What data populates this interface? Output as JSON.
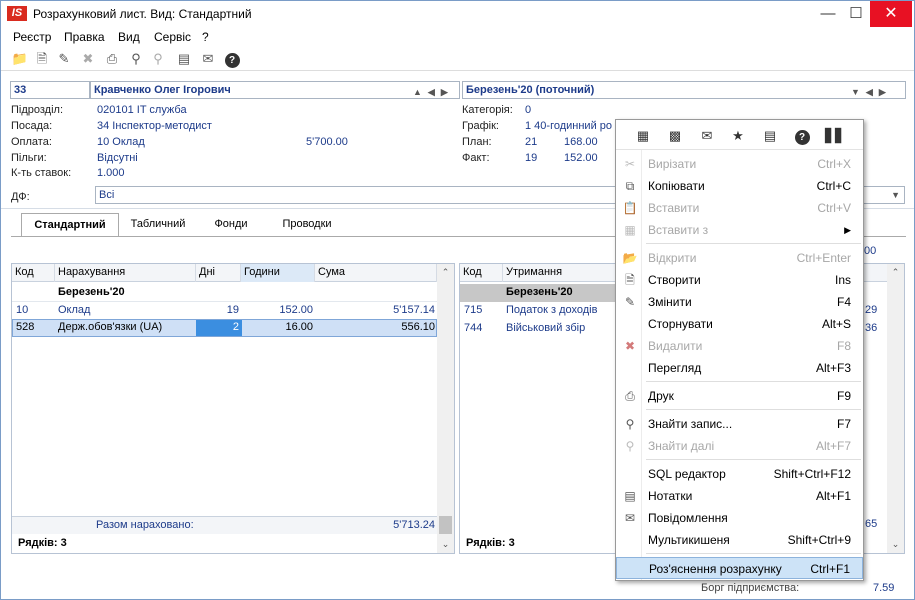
{
  "window": {
    "app_icon": "IS",
    "title": "Розрахунковий лист. Вид: Стандартний",
    "min_icon": "minimize-icon",
    "max_icon": "maximize-icon",
    "close_icon": "close-icon"
  },
  "menu": [
    "Реєстр",
    "Правка",
    "Вид",
    "Сервіс",
    "?"
  ],
  "toolbar_icons": [
    "folder-icon",
    "new-doc-icon",
    "edit-doc-icon",
    "delete-icon",
    "print-icon",
    "find-icon",
    "find-next-icon",
    "notes-icon",
    "mail-icon",
    "help-icon"
  ],
  "header": {
    "employee_id": "33",
    "employee_name": "Кравченко Олег Ігорович",
    "period": "Березень'20 (поточний)"
  },
  "info_left": {
    "department_label": "Підрозділ:",
    "department_value": "020101  IT служба",
    "position_label": "Посада:",
    "position_value": "34  Інспектор-методист",
    "pay_label": "Оплата:",
    "pay_value": "10  Оклад",
    "pay_amount": "5'700.00",
    "benefits_label": "Пільги:",
    "benefits_value": "Відсутні",
    "rate_label": "К-ть ставок:",
    "rate_value": "1.000",
    "df_label": "ДФ:",
    "df_value": "Всі"
  },
  "info_right": {
    "category_label": "Категорія:",
    "category_value": "0",
    "schedule_label": "Графік:",
    "schedule_value": "1  40-годинний ро",
    "plan_label": "План:",
    "plan_days": "21",
    "plan_hours": "168.00",
    "fact_label": "Факт:",
    "fact_days": "19",
    "fact_hours": "152.00"
  },
  "tabs": [
    "Стандартний",
    "Табличний",
    "Фонди",
    "Проводки"
  ],
  "accruals": {
    "columns": [
      "Код",
      "Нарахування",
      "Дні",
      "Години",
      "Сума"
    ],
    "group_title": "Березень'20",
    "rows": [
      {
        "code": "10",
        "name": "Оклад",
        "days": "19",
        "hours": "152.00",
        "sum": "5'157.14"
      },
      {
        "code": "528",
        "name": "Держ.обов'язки (UA)",
        "days": "2",
        "hours": "16.00",
        "sum": "556.10"
      }
    ],
    "total_label": "Разом нараховано:",
    "total_value": "5'713.24",
    "rows_count": "Рядків: 3"
  },
  "deductions": {
    "columns": [
      "Код",
      "Утримання"
    ],
    "group_title": "Березень'20",
    "rows": [
      {
        "code": "715",
        "name": "Податок з доходів",
        "tail": "29"
      },
      {
        "code": "744",
        "name": "Військовий збір",
        "tail": "36"
      }
    ],
    "right_top_value": ".00",
    "total_tail": "65",
    "rows_count": "Рядків: 3",
    "bottom_partial_label": "Борг підприємства:",
    "bottom_partial_value": "7.59"
  },
  "context_menu": {
    "toolbar_icons": [
      "calculator-icon",
      "table-icon",
      "mail-icon",
      "star-icon",
      "notes-icon",
      "help-icon",
      "chart-icon"
    ],
    "items": [
      {
        "label": "Вирізати",
        "shortcut": "Ctrl+X",
        "icon": "scissors-icon",
        "disabled": true
      },
      {
        "label": "Копіювати",
        "shortcut": "Ctrl+C",
        "icon": "copy-icon",
        "disabled": false
      },
      {
        "label": "Вставити",
        "shortcut": "Ctrl+V",
        "icon": "paste-icon",
        "disabled": true
      },
      {
        "label": "Вставити з",
        "shortcut": "",
        "icon": "paste-from-icon",
        "disabled": true,
        "submenu": true
      },
      {
        "label": "Відкрити",
        "shortcut": "Ctrl+Enter",
        "icon": "open-icon",
        "disabled": true
      },
      {
        "label": "Створити",
        "shortcut": "Ins",
        "icon": "create-icon",
        "disabled": false
      },
      {
        "label": "Змінити",
        "shortcut": "F4",
        "icon": "edit-icon",
        "disabled": false
      },
      {
        "label": "Сторнувати",
        "shortcut": "Alt+S",
        "icon": "",
        "disabled": false
      },
      {
        "label": "Видалити",
        "shortcut": "F8",
        "icon": "delete-icon",
        "disabled": true
      },
      {
        "label": "Перегляд",
        "shortcut": "Alt+F3",
        "icon": "",
        "disabled": false
      },
      {
        "label": "Друк",
        "shortcut": "F9",
        "icon": "print-icon",
        "disabled": false
      },
      {
        "label": "Знайти запис...",
        "shortcut": "F7",
        "icon": "find-icon",
        "disabled": false
      },
      {
        "label": "Знайти далі",
        "shortcut": "Alt+F7",
        "icon": "find-next-icon",
        "disabled": true
      },
      {
        "label": "SQL редактор",
        "shortcut": "Shift+Ctrl+F12",
        "icon": "",
        "disabled": false
      },
      {
        "label": "Нотатки",
        "shortcut": "Alt+F1",
        "icon": "notes-icon",
        "disabled": false
      },
      {
        "label": "Повідомлення",
        "shortcut": "",
        "icon": "mail-icon",
        "disabled": false
      },
      {
        "label": "Мультикишеня",
        "shortcut": "Shift+Ctrl+9",
        "icon": "",
        "disabled": false
      },
      {
        "label": "Роз'яснення розрахунку",
        "shortcut": "Ctrl+F1",
        "icon": "",
        "disabled": false,
        "highlighted": true
      }
    ]
  }
}
